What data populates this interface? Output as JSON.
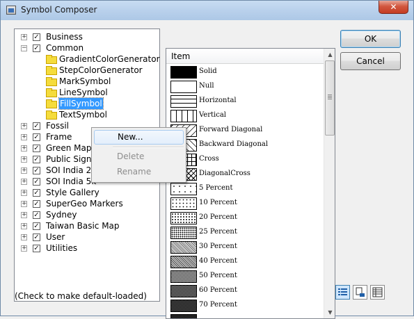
{
  "window": {
    "title": "Symbol Composer",
    "close_label": "✕"
  },
  "tree": {
    "top_level": [
      {
        "label": "Business",
        "expanded": false
      },
      {
        "label": "Common",
        "expanded": true
      },
      {
        "label": "Fossil",
        "expanded": false
      },
      {
        "label": "Frame",
        "expanded": false
      },
      {
        "label": "Green Map",
        "expanded": false
      },
      {
        "label": "Public Signs",
        "expanded": false
      },
      {
        "label": "SOI India 25k",
        "expanded": false
      },
      {
        "label": "SOI India 5k",
        "expanded": false
      },
      {
        "label": "Style Gallery",
        "expanded": false
      },
      {
        "label": "SuperGeo Markers",
        "expanded": false
      },
      {
        "label": "Sydney",
        "expanded": false
      },
      {
        "label": "Taiwan Basic Map",
        "expanded": false
      },
      {
        "label": "User",
        "expanded": false
      },
      {
        "label": "Utilities",
        "expanded": false
      }
    ],
    "common_children": [
      {
        "label": "GradientColorGenerator"
      },
      {
        "label": "StepColorGenerator"
      },
      {
        "label": "MarkSymbol"
      },
      {
        "label": "LineSymbol"
      },
      {
        "label": "FillSymbol",
        "selected": true
      },
      {
        "label": "TextSymbol"
      }
    ],
    "hint": "(Check to make default-loaded)"
  },
  "context_menu": {
    "items": [
      {
        "label": "New...",
        "enabled": true
      },
      {
        "label": "Delete",
        "enabled": false
      },
      {
        "label": "Rename",
        "enabled": false
      }
    ]
  },
  "symbol_list": {
    "header": "Item",
    "items": [
      {
        "label": "Solid",
        "pattern": "solid"
      },
      {
        "label": "Null",
        "pattern": "null"
      },
      {
        "label": "Horizontal",
        "pattern": "horizontal"
      },
      {
        "label": "Vertical",
        "pattern": "vertical"
      },
      {
        "label": "Forward Diagonal",
        "pattern": "fdiag"
      },
      {
        "label": "Backward Diagonal",
        "pattern": "bdiag"
      },
      {
        "label": "Cross",
        "pattern": "cross"
      },
      {
        "label": "DiagonalCross",
        "pattern": "dcross"
      },
      {
        "label": "5 Percent",
        "pattern": "p5"
      },
      {
        "label": "10 Percent",
        "pattern": "p10"
      },
      {
        "label": "20 Percent",
        "pattern": "p20"
      },
      {
        "label": "25 Percent",
        "pattern": "p25"
      },
      {
        "label": "30 Percent",
        "pattern": "p30"
      },
      {
        "label": "40 Percent",
        "pattern": "p40"
      },
      {
        "label": "50 Percent",
        "pattern": "p50"
      },
      {
        "label": "60 Percent",
        "pattern": "p60"
      },
      {
        "label": "70 Percent",
        "pattern": "p70"
      },
      {
        "label": "",
        "pattern": "p75"
      }
    ]
  },
  "buttons": {
    "ok": "OK",
    "cancel": "Cancel"
  },
  "view_buttons": [
    {
      "name": "list-view-icon",
      "active": true
    },
    {
      "name": "detail-view-icon",
      "active": false
    },
    {
      "name": "grid-view-icon",
      "active": false
    }
  ],
  "colors": {
    "selection": "#3399ff",
    "accent_border": "#3c7fb1"
  }
}
